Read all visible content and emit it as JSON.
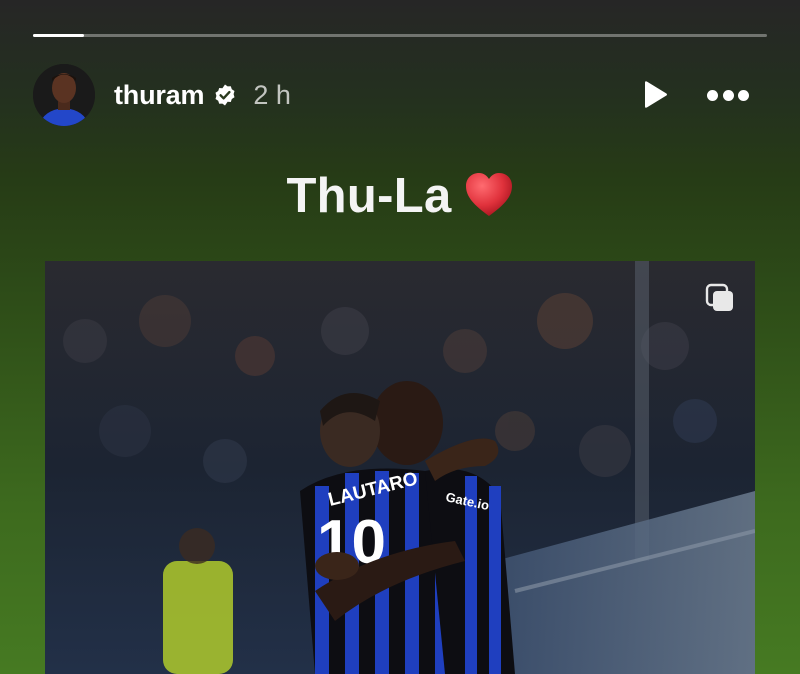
{
  "story": {
    "progress_fraction": 0.07
  },
  "header": {
    "username": "thuram",
    "time": "2 h",
    "icons": {
      "verified": "verified-badge-icon",
      "play": "play-icon",
      "more": "more-options-icon",
      "carousel": "multiple-images-icon"
    }
  },
  "caption": {
    "text": "Thu-La"
  },
  "photo": {
    "jersey_name": "LAUTARO",
    "jersey_number": "10",
    "sponsor": "Gate.io"
  },
  "colors": {
    "inter_blue": "#1f3fbf",
    "inter_black": "#0d0d12",
    "heart_red": "#e0323c",
    "verified_white": "#ffffff"
  }
}
